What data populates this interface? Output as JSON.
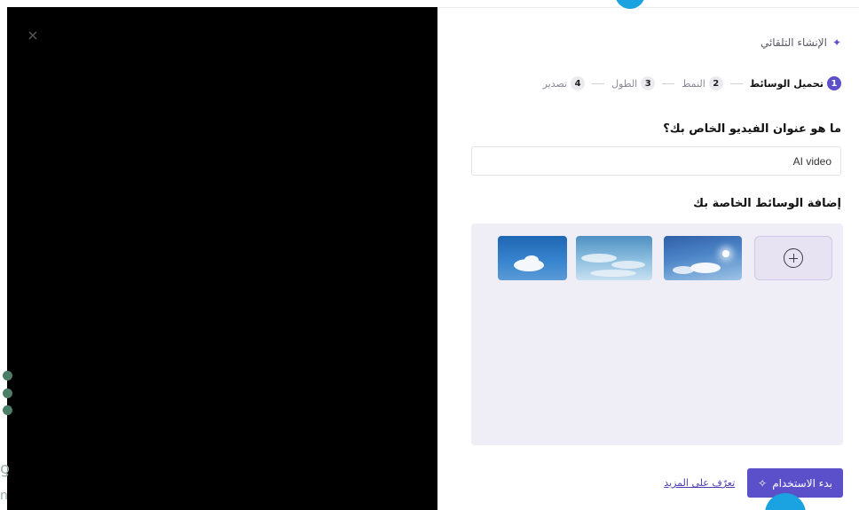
{
  "preview": {
    "close_symbol": "×"
  },
  "header": {
    "title": "الإنشاء التلقائي",
    "icon": "sparkle-icon"
  },
  "steps": [
    {
      "num": "1",
      "label": "تحميل الوسائط",
      "active": true
    },
    {
      "num": "2",
      "label": "النمط",
      "active": false
    },
    {
      "num": "3",
      "label": "الطول",
      "active": false
    },
    {
      "num": "4",
      "label": "تصدير",
      "active": false
    }
  ],
  "video_title": {
    "question": "ما هو عنوان الفيديو الخاص بك؟",
    "value": "AI video"
  },
  "media": {
    "heading": "إضافة الوسائط الخاصة بك",
    "add_icon": "plus-circle-icon"
  },
  "footer": {
    "start_label": "بدء الاستخدام",
    "learn_more": "تعرّف على المزيد"
  },
  "colors": {
    "accent": "#5b50c9",
    "preview_bg": "#000000",
    "media_bg": "#efedf5",
    "blue_marker": "#1aa3e0"
  }
}
